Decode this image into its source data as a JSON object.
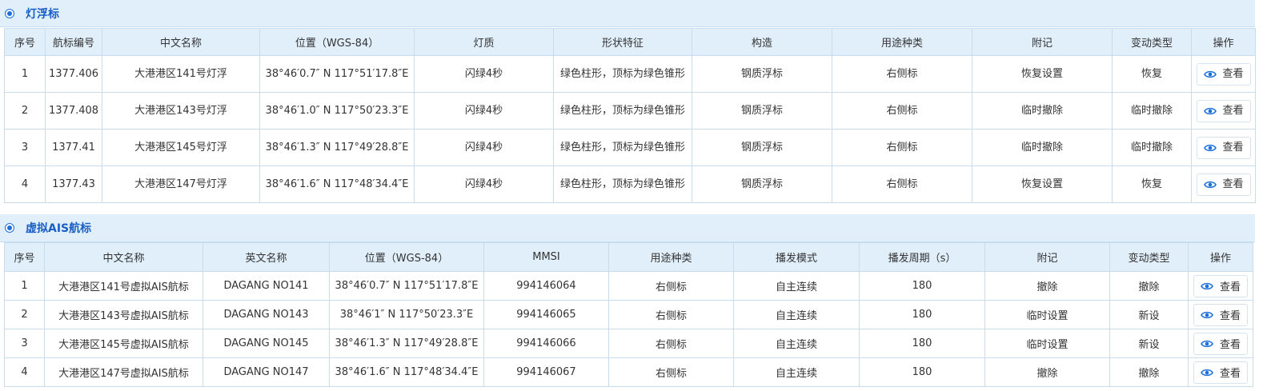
{
  "sections": [
    {
      "title": "灯浮标",
      "columns": [
        "序号",
        "航标编号",
        "中文名称",
        "位置（WGS-84）",
        "灯质",
        "形状特征",
        "构造",
        "用途种类",
        "附记",
        "变动类型",
        "操作"
      ],
      "rows": [
        {
          "no": "1",
          "code": "1377.406",
          "name": "大港港区141号灯浮",
          "position": "38°46′0.7″ N 117°51′17.8″E",
          "light": "闪绿4秒",
          "shape": "绿色柱形，顶标为绿色锥形",
          "structure": "钢质浮标",
          "usage": "右侧标",
          "remark": "恢复设置",
          "change": "恢复"
        },
        {
          "no": "2",
          "code": "1377.408",
          "name": "大港港区143号灯浮",
          "position": "38°46′1.0″ N 117°50′23.3″E",
          "light": "闪绿4秒",
          "shape": "绿色柱形，顶标为绿色锥形",
          "structure": "钢质浮标",
          "usage": "右侧标",
          "remark": "临时撤除",
          "change": "临时撤除"
        },
        {
          "no": "3",
          "code": "1377.41",
          "name": "大港港区145号灯浮",
          "position": "38°46′1.3″ N 117°49′28.8″E",
          "light": "闪绿4秒",
          "shape": "绿色柱形，顶标为绿色锥形",
          "structure": "钢质浮标",
          "usage": "右侧标",
          "remark": "临时撤除",
          "change": "临时撤除"
        },
        {
          "no": "4",
          "code": "1377.43",
          "name": "大港港区147号灯浮",
          "position": "38°46′1.6″ N 117°48′34.4″E",
          "light": "闪绿4秒",
          "shape": "绿色柱形，顶标为绿色锥形",
          "structure": "钢质浮标",
          "usage": "右侧标",
          "remark": "恢复设置",
          "change": "恢复"
        }
      ]
    },
    {
      "title": "虚拟AIS航标",
      "columns": [
        "序号",
        "中文名称",
        "英文名称",
        "位置（WGS-84）",
        "MMSI",
        "用途种类",
        "播发模式",
        "播发周期（s）",
        "附记",
        "变动类型",
        "操作"
      ],
      "rows": [
        {
          "no": "1",
          "name": "大港港区141号虚拟AIS航标",
          "en_name": "DAGANG NO141",
          "position": "38°46′0.7″ N 117°51′17.8″E",
          "mmsi": "994146064",
          "usage": "右侧标",
          "mode": "自主连续",
          "period": "180",
          "remark": "撤除",
          "change": "撤除"
        },
        {
          "no": "2",
          "name": "大港港区143号虚拟AIS航标",
          "en_name": "DAGANG NO143",
          "position": "38°46′1″ N 117°50′23.3″E",
          "mmsi": "994146065",
          "usage": "右侧标",
          "mode": "自主连续",
          "period": "180",
          "remark": "临时设置",
          "change": "新设"
        },
        {
          "no": "3",
          "name": "大港港区145号虚拟AIS航标",
          "en_name": "DAGANG NO145",
          "position": "38°46′1.3″ N 117°49′28.8″E",
          "mmsi": "994146066",
          "usage": "右侧标",
          "mode": "自主连续",
          "period": "180",
          "remark": "临时设置",
          "change": "新设"
        },
        {
          "no": "4",
          "name": "大港港区147号虚拟AIS航标",
          "en_name": "DAGANG NO147",
          "position": "38°46′1.6″ N 117°48′34.4″E",
          "mmsi": "994146067",
          "usage": "右侧标",
          "mode": "自主连续",
          "period": "180",
          "remark": "撤除",
          "change": "撤除"
        }
      ]
    }
  ],
  "actions": {
    "view_label": "查看"
  },
  "icons": {
    "section": "radio-selected-icon",
    "view": "eye-icon"
  },
  "colors": {
    "accent": "#1e6fd9",
    "header_bg": "#e1effa",
    "border": "#c8dced",
    "title": "#1a5fc4"
  }
}
